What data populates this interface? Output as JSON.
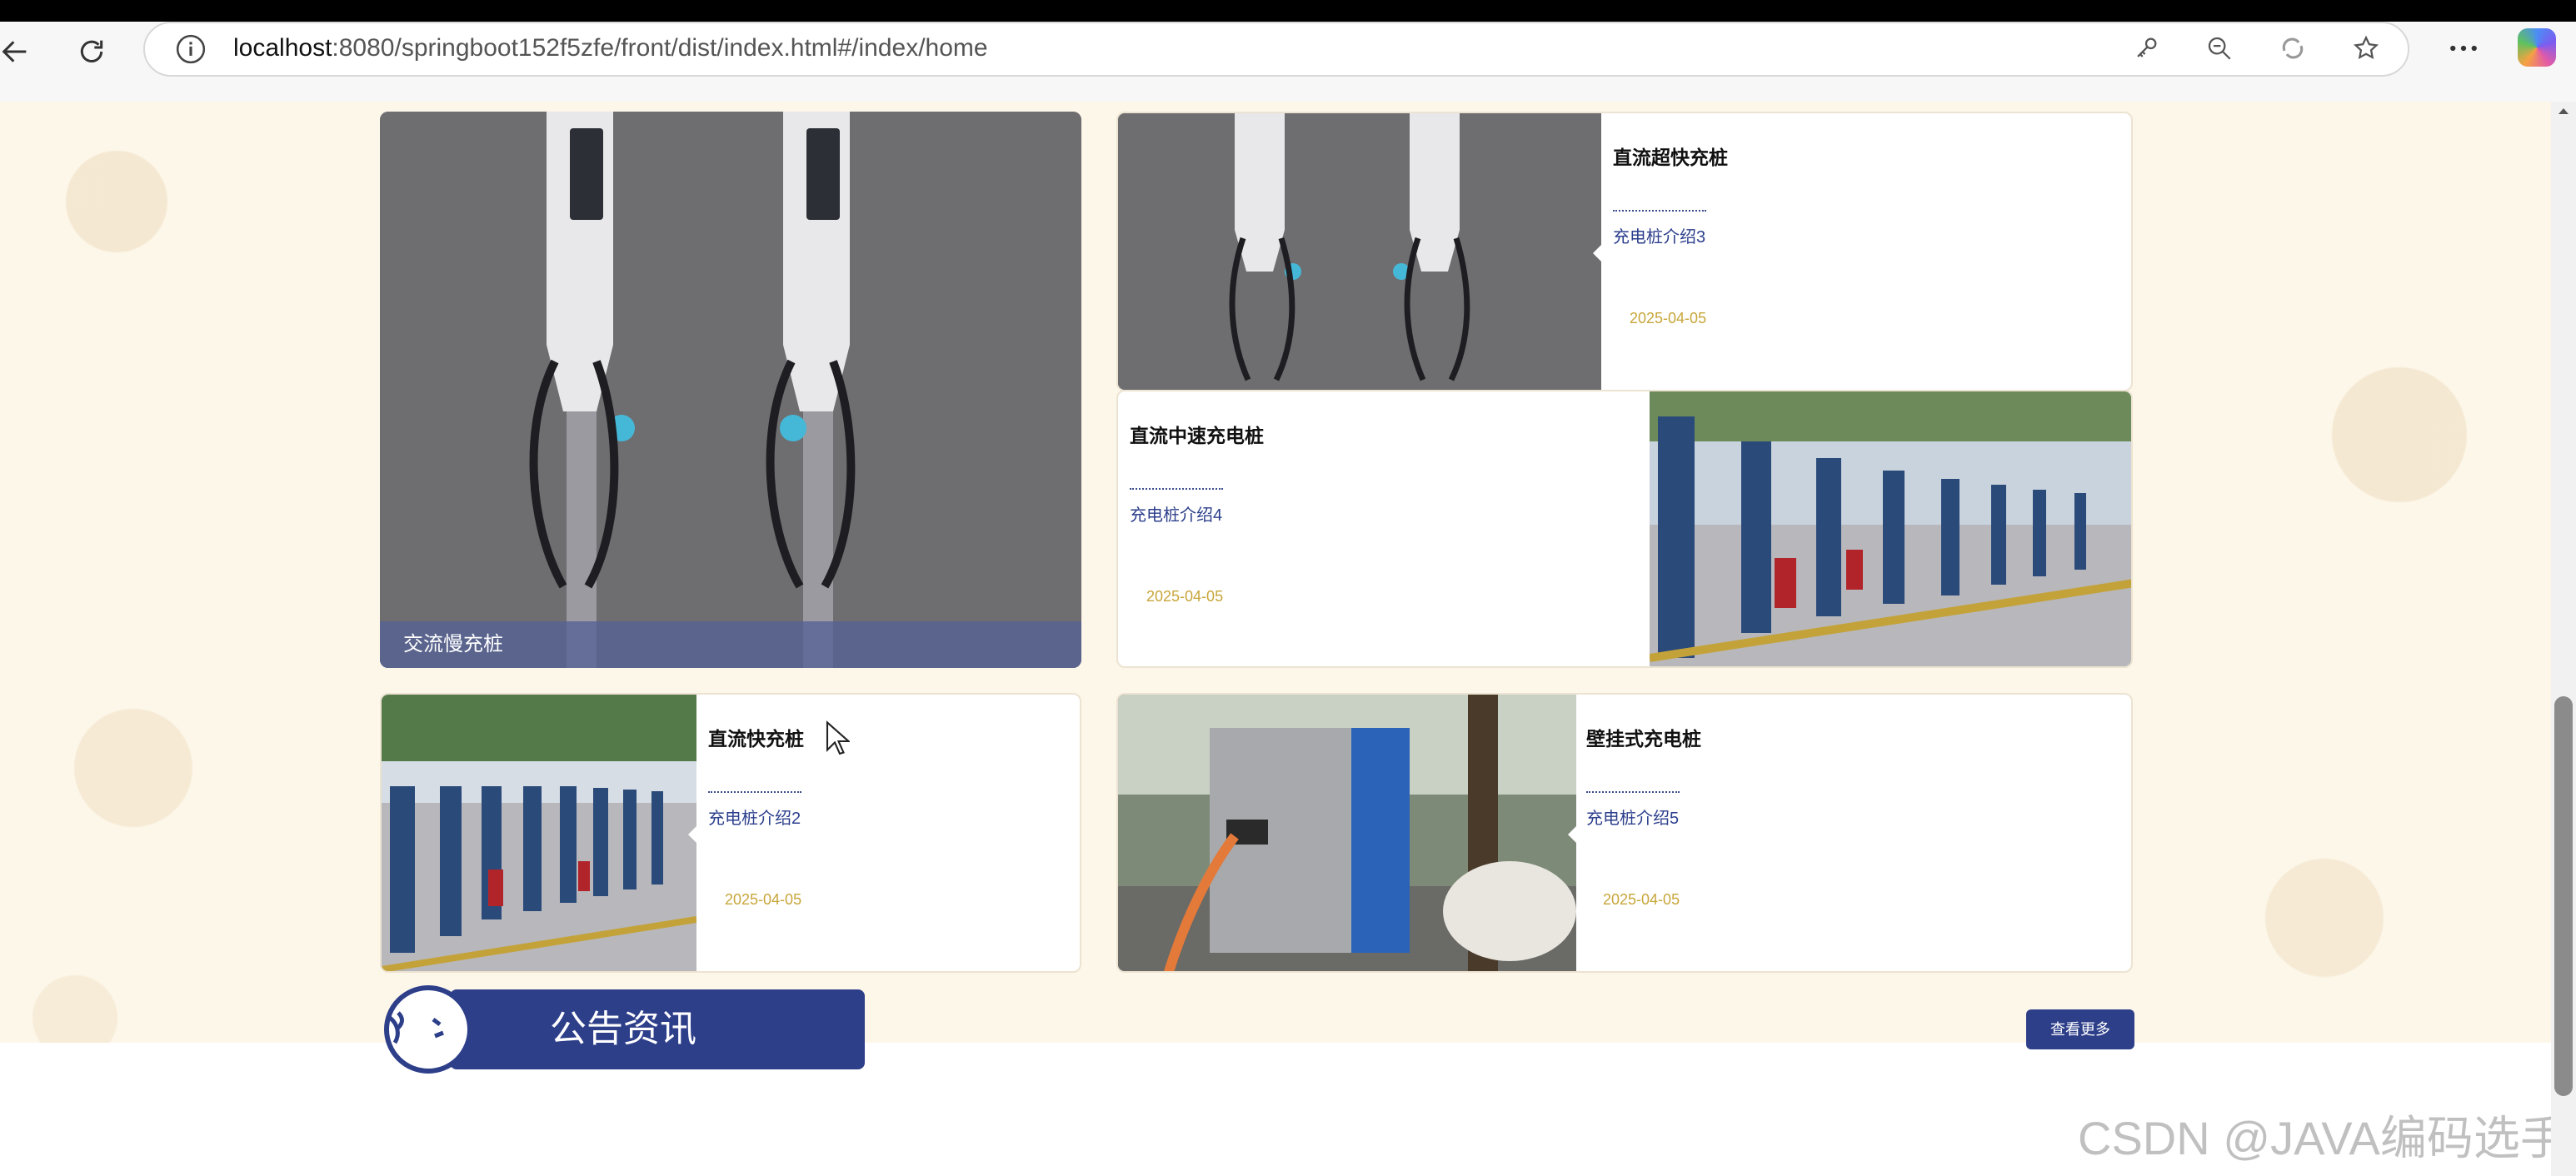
{
  "browser": {
    "url_host": "localhost",
    "url_rest": ":8080/springboot152f5zfe/front/dist/index.html#/index/home"
  },
  "products": {
    "big": {
      "title": "交流慢充桩"
    },
    "items": [
      {
        "title": "直流超快充桩",
        "desc": "充电桩介绍3",
        "date": "2025-04-05"
      },
      {
        "title": "直流中速充电桩",
        "desc": "充电桩介绍4",
        "date": "2025-04-05"
      },
      {
        "title": "直流快充桩",
        "desc": "充电桩介绍2",
        "date": "2025-04-05"
      },
      {
        "title": "壁挂式充电桩",
        "desc": "充电桩介绍5",
        "date": "2025-04-05"
      }
    ]
  },
  "announcements": {
    "title": "公告资讯",
    "more_label": "查看更多"
  },
  "watermark": "CSDN @JAVA编码选手"
}
